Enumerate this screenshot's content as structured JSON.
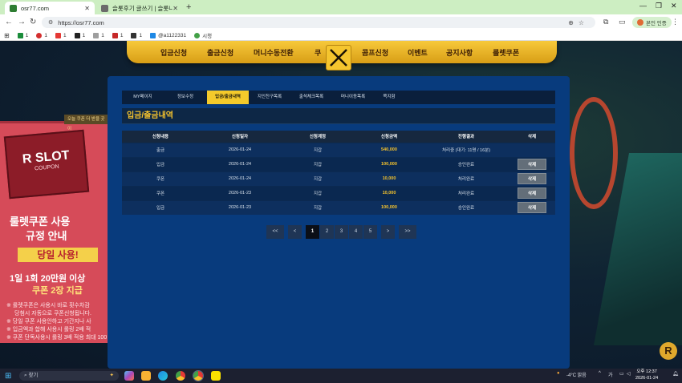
{
  "browser": {
    "tabs": [
      {
        "title": "osr77.com",
        "favicon_color": "#2e7d32",
        "active": true
      },
      {
        "title": "슬롯후기 글쓰기 | 슬롯나라 - ..",
        "favicon_color": "#6b6b6b",
        "active": false
      }
    ],
    "address": "https://osr77.com",
    "profile_label": "본인 인증",
    "bookmarks": [
      {
        "label": "1",
        "color": "#1a8c3a"
      },
      {
        "label": "1",
        "color": "#d32f2f"
      },
      {
        "label": "1",
        "color": "#e53935"
      },
      {
        "label": "1",
        "color": "#222222"
      },
      {
        "label": "1",
        "color": "#9e9e9e"
      },
      {
        "label": "1",
        "color": "#c62828"
      },
      {
        "label": "1",
        "color": "#333333"
      },
      {
        "label": "@a1122331",
        "color": "#1e88e5"
      },
      {
        "label": "시청",
        "color": "#43a047"
      }
    ]
  },
  "site": {
    "nav": [
      "입금신청",
      "출금신청",
      "머니수동전환",
      "쿠",
      "콤프신청",
      "이벤트",
      "공지사항",
      "룰렛쿠폰"
    ],
    "close_icon": "close-x-icon"
  },
  "deco": {
    "notice": "오늘 쿠폰 더 받을 곳이",
    "coupon_title": "R SLOT",
    "coupon_sub": "COUPON",
    "headline1": "룰렛쿠폰 사용",
    "headline2": "규정 안내",
    "tag": "당일 사용!",
    "line1": "1일 1회 20만원 이상",
    "line2": "쿠폰 2장 지급",
    "note1": "※ 룰렛쿠폰은 사용시 바로 횟수차감",
    "note2": "당첨시 자동으로 쿠폰신청됩니다.",
    "note3": "※ 당일 쿠폰 사용안하고 기간지나 사",
    "note4": "※ 입금액과 합해 사용시 롤링 2배 적",
    "note5": "※ 쿠폰 단독사용시 롤링 3배 적용 최대 100",
    "logo": "R"
  },
  "panel": {
    "tabs": [
      {
        "label": "MY페이지",
        "active": false
      },
      {
        "label": "정보수정",
        "active": false
      },
      {
        "label": "입금/출금내역",
        "active": true
      },
      {
        "label": "지인친구목록",
        "active": false
      },
      {
        "label": "출석체크목록",
        "active": false
      },
      {
        "label": "머니이동목록",
        "active": false
      },
      {
        "label": "쪽지함",
        "active": false
      }
    ],
    "title": "입금/출금내역",
    "columns": [
      "신청내용",
      "신청일자",
      "신청계정",
      "신청금액",
      "진행결과",
      "삭제"
    ],
    "rows": [
      {
        "type": "출금",
        "date": "2026-01-24",
        "account": "지갑",
        "amount": "540,000",
        "result": "처리중 (대기: 11명 / 16분)",
        "delete": ""
      },
      {
        "type": "입금",
        "date": "2026-01-24",
        "account": "지갑",
        "amount": "100,000",
        "result": "승인완료",
        "delete": "삭제"
      },
      {
        "type": "쿠폰",
        "date": "2026-01-24",
        "account": "지갑",
        "amount": "10,000",
        "result": "처리완료",
        "delete": "삭제"
      },
      {
        "type": "쿠폰",
        "date": "2026-01-23",
        "account": "지갑",
        "amount": "10,000",
        "result": "처리완료",
        "delete": "삭제"
      },
      {
        "type": "입금",
        "date": "2026-01-23",
        "account": "지갑",
        "amount": "100,000",
        "result": "승인완료",
        "delete": "삭제"
      }
    ],
    "pager": {
      "first": "<<",
      "prev": "<",
      "pages": [
        "1",
        "2",
        "3",
        "4",
        "5"
      ],
      "current": "1",
      "next": ">",
      "last": ">>"
    }
  },
  "taskbar": {
    "search_placeholder": "찾기",
    "weather": "-4°C 맑음",
    "time": "오후 12:37",
    "date": "2026-01-24"
  },
  "colors": {
    "accent": "#f4ca2b",
    "panel_bg": "#083b7d",
    "amount": "#f4c22d"
  }
}
